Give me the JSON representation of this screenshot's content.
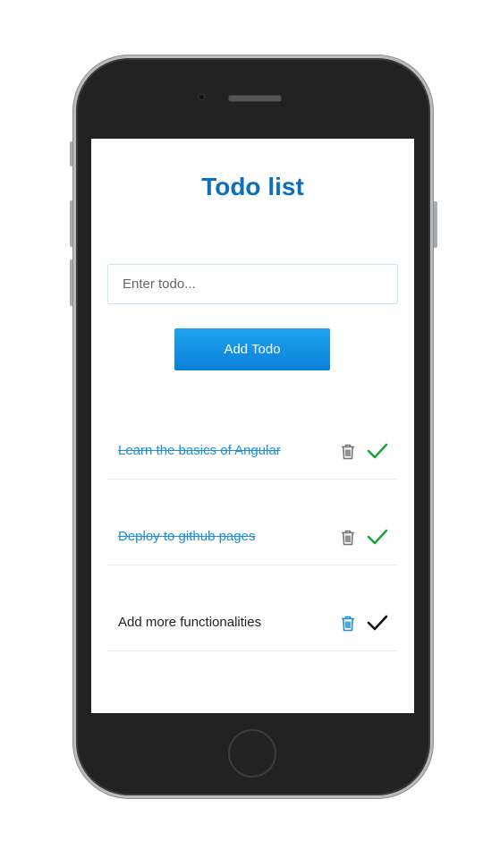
{
  "app": {
    "title": "Todo list"
  },
  "input": {
    "placeholder": "Enter todo...",
    "value": ""
  },
  "add_button": {
    "label": "Add Todo"
  },
  "todos": [
    {
      "text": "Learn the basics of Angular",
      "completed": true
    },
    {
      "text": "Deploy to github pages",
      "completed": true
    },
    {
      "text": "Add more functionalities",
      "completed": false
    }
  ],
  "colors": {
    "title": "#0a6fbd",
    "button": "#0a81d8",
    "completed_text": "#1e8fd6",
    "check_completed": "#1aa83b",
    "check_pending": "#111111",
    "trash_default": "#777777",
    "trash_active": "#1e8fd6"
  },
  "icons": {
    "delete": "trash-icon",
    "complete": "checkmark-icon"
  }
}
